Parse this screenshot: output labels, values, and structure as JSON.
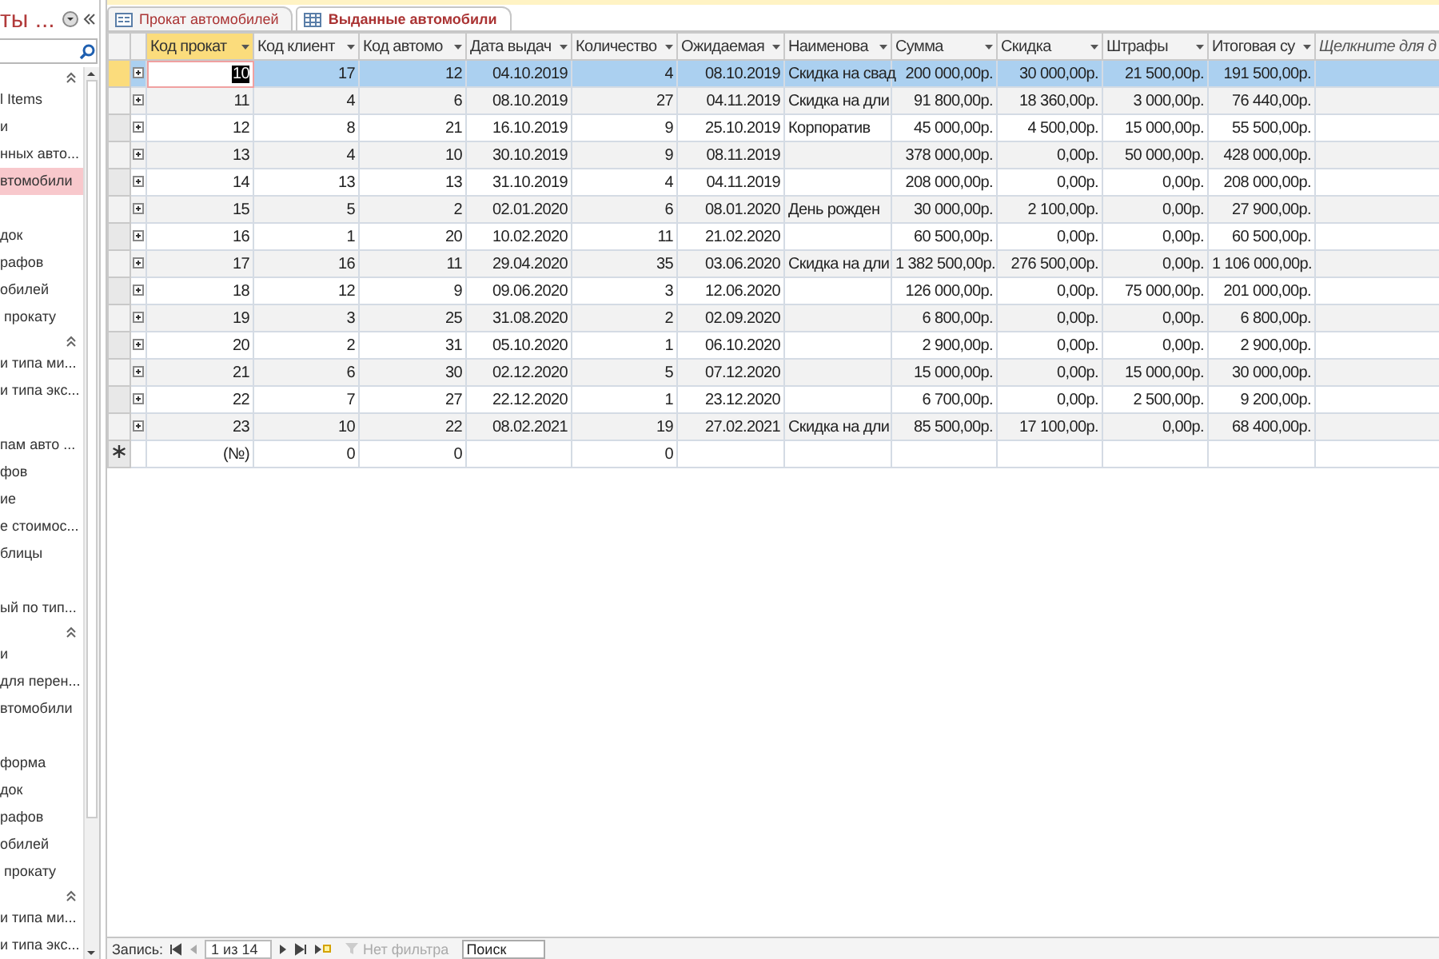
{
  "nav_pane": {
    "title": "ты ...",
    "groups": [
      {
        "items": [
          {
            "label": "l Items",
            "selected": false
          },
          {
            "label": "и",
            "selected": false
          },
          {
            "label": "нных авто...",
            "selected": false
          },
          {
            "label": "втомобили",
            "selected": true
          },
          {
            "label": "док",
            "selected": false,
            "gap_before": true
          },
          {
            "label": "рафов",
            "selected": false
          },
          {
            "label": "обилей",
            "selected": false
          },
          {
            "label": " прокату",
            "selected": false
          }
        ]
      },
      {
        "items": [
          {
            "label": "и типа ми...",
            "selected": false
          },
          {
            "label": "и типа экс...",
            "selected": false
          },
          {
            "label": "пам авто ...",
            "selected": false,
            "gap_before": true
          },
          {
            "label": "фов",
            "selected": false
          },
          {
            "label": "ие",
            "selected": false
          },
          {
            "label": "е стоимос...",
            "selected": false
          },
          {
            "label": "блицы",
            "selected": false
          },
          {
            "label": "ый по тип...",
            "selected": false,
            "gap_before": true
          }
        ]
      },
      {
        "items": [
          {
            "label": "и",
            "selected": false
          },
          {
            "label": "для перен...",
            "selected": false
          },
          {
            "label": "втомобили",
            "selected": false
          },
          {
            "label": "форма",
            "selected": false,
            "gap_before": true
          },
          {
            "label": "док",
            "selected": false
          },
          {
            "label": "рафов",
            "selected": false
          },
          {
            "label": "обилей",
            "selected": false
          },
          {
            "label": " прокату",
            "selected": false
          }
        ]
      },
      {
        "items": [
          {
            "label": "и типа ми...",
            "selected": false
          },
          {
            "label": "и типа экс...",
            "selected": false
          }
        ]
      }
    ]
  },
  "tabs": [
    {
      "label": "Прокат автомобилей",
      "kind": "form",
      "selected": false
    },
    {
      "label": "Выданные автомобили",
      "kind": "table",
      "selected": true
    }
  ],
  "table": {
    "columns": [
      {
        "label": "Код прокат",
        "selected": true
      },
      {
        "label": "Код клиент",
        "selected": false
      },
      {
        "label": "Код автомо",
        "selected": false
      },
      {
        "label": "Дата выдач",
        "selected": false
      },
      {
        "label": "Количество",
        "selected": false
      },
      {
        "label": "Ожидаемая",
        "selected": false
      },
      {
        "label": "Наименова",
        "selected": false
      },
      {
        "label": "Сумма",
        "selected": false
      },
      {
        "label": "Скидка",
        "selected": false
      },
      {
        "label": "Штрафы",
        "selected": false
      },
      {
        "label": "Итоговая су",
        "selected": false
      }
    ],
    "add_column": "Щелкните для д",
    "rows": [
      {
        "selected": true,
        "id": "10",
        "client": "17",
        "car": "12",
        "issued": "04.10.2019",
        "count": "4",
        "expected": "08.10.2019",
        "name": "Скидка на свад",
        "sum": "200 000,00р.",
        "discount": "30 000,00р.",
        "fines": "21 500,00р.",
        "total": "191 500,00р."
      },
      {
        "selected": false,
        "id": "11",
        "client": "4",
        "car": "6",
        "issued": "08.10.2019",
        "count": "27",
        "expected": "04.11.2019",
        "name": "Скидка на дли",
        "sum": "91 800,00р.",
        "discount": "18 360,00р.",
        "fines": "3 000,00р.",
        "total": "76 440,00р."
      },
      {
        "selected": false,
        "id": "12",
        "client": "8",
        "car": "21",
        "issued": "16.10.2019",
        "count": "9",
        "expected": "25.10.2019",
        "name": "Корпоратив",
        "sum": "45 000,00р.",
        "discount": "4 500,00р.",
        "fines": "15 000,00р.",
        "total": "55 500,00р."
      },
      {
        "selected": false,
        "id": "13",
        "client": "4",
        "car": "10",
        "issued": "30.10.2019",
        "count": "9",
        "expected": "08.11.2019",
        "sum": "378 000,00р.",
        "discount": "0,00р.",
        "fines": "50 000,00р.",
        "total": "428 000,00р."
      },
      {
        "selected": false,
        "id": "14",
        "client": "13",
        "car": "13",
        "issued": "31.10.2019",
        "count": "4",
        "expected": "04.11.2019",
        "sum": "208 000,00р.",
        "discount": "0,00р.",
        "fines": "0,00р.",
        "total": "208 000,00р."
      },
      {
        "selected": false,
        "id": "15",
        "client": "5",
        "car": "2",
        "issued": "02.01.2020",
        "count": "6",
        "expected": "08.01.2020",
        "name": "День рожден",
        "sum": "30 000,00р.",
        "discount": "2 100,00р.",
        "fines": "0,00р.",
        "total": "27 900,00р."
      },
      {
        "selected": false,
        "id": "16",
        "client": "1",
        "car": "20",
        "issued": "10.02.2020",
        "count": "11",
        "expected": "21.02.2020",
        "sum": "60 500,00р.",
        "discount": "0,00р.",
        "fines": "0,00р.",
        "total": "60 500,00р."
      },
      {
        "selected": false,
        "id": "17",
        "client": "16",
        "car": "11",
        "issued": "29.04.2020",
        "count": "35",
        "expected": "03.06.2020",
        "name": "Скидка на дли",
        "sum": "1 382 500,00р.",
        "discount": "276 500,00р.",
        "fines": "0,00р.",
        "total": "1 106 000,00р."
      },
      {
        "selected": false,
        "id": "18",
        "client": "12",
        "car": "9",
        "issued": "09.06.2020",
        "count": "3",
        "expected": "12.06.2020",
        "sum": "126 000,00р.",
        "discount": "0,00р.",
        "fines": "75 000,00р.",
        "total": "201 000,00р."
      },
      {
        "selected": false,
        "id": "19",
        "client": "3",
        "car": "25",
        "issued": "31.08.2020",
        "count": "2",
        "expected": "02.09.2020",
        "sum": "6 800,00р.",
        "discount": "0,00р.",
        "fines": "0,00р.",
        "total": "6 800,00р."
      },
      {
        "selected": false,
        "id": "20",
        "client": "2",
        "car": "31",
        "issued": "05.10.2020",
        "count": "1",
        "expected": "06.10.2020",
        "sum": "2 900,00р.",
        "discount": "0,00р.",
        "fines": "0,00р.",
        "total": "2 900,00р."
      },
      {
        "selected": false,
        "id": "21",
        "client": "6",
        "car": "30",
        "issued": "02.12.2020",
        "count": "5",
        "expected": "07.12.2020",
        "sum": "15 000,00р.",
        "discount": "0,00р.",
        "fines": "15 000,00р.",
        "total": "30 000,00р."
      },
      {
        "selected": false,
        "id": "22",
        "client": "7",
        "car": "27",
        "issued": "22.12.2020",
        "count": "1",
        "expected": "23.12.2020",
        "sum": "6 700,00р.",
        "discount": "0,00р.",
        "fines": "2 500,00р.",
        "total": "9 200,00р."
      },
      {
        "selected": false,
        "id": "23",
        "client": "10",
        "car": "22",
        "issued": "08.02.2021",
        "count": "19",
        "expected": "27.02.2021",
        "name": "Скидка на дли",
        "sum": "85 500,00р.",
        "discount": "17 100,00р.",
        "fines": "0,00р.",
        "total": "68 400,00р."
      }
    ],
    "new_row": {
      "id": "(№)",
      "client": "0",
      "car": "0",
      "count": "0"
    }
  },
  "record_nav": {
    "label": "Запись:",
    "position": "1 из 14",
    "filter": "Нет фильтра",
    "search_placeholder": "Поиск"
  }
}
